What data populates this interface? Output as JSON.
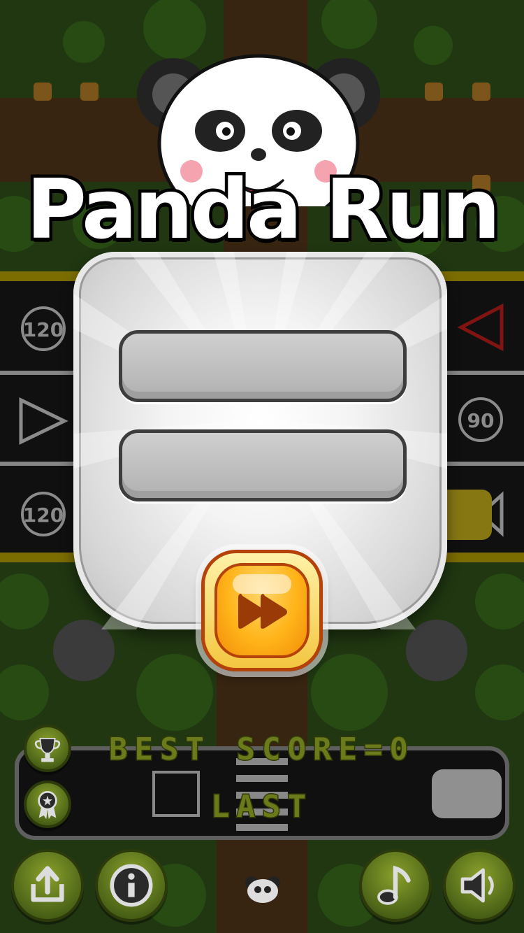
{
  "game": {
    "title": "Panda Run"
  },
  "score": {
    "best_label": "BEST SCORE=0",
    "last_label": "LAST"
  },
  "road_signs": [
    "120",
    "90",
    "120"
  ],
  "buttons": {
    "play": "play-button",
    "trophy": "trophy-button",
    "achievements": "achievements-button",
    "share": "share-button",
    "info": "info-button",
    "music": "music-button",
    "sound": "sound-button"
  },
  "colors": {
    "grass": "#2d4a17",
    "road": "#1b1b1b",
    "panel": "#e8e8e8",
    "play_orange": "#ffb419",
    "button_green": "#5a7a1e"
  }
}
